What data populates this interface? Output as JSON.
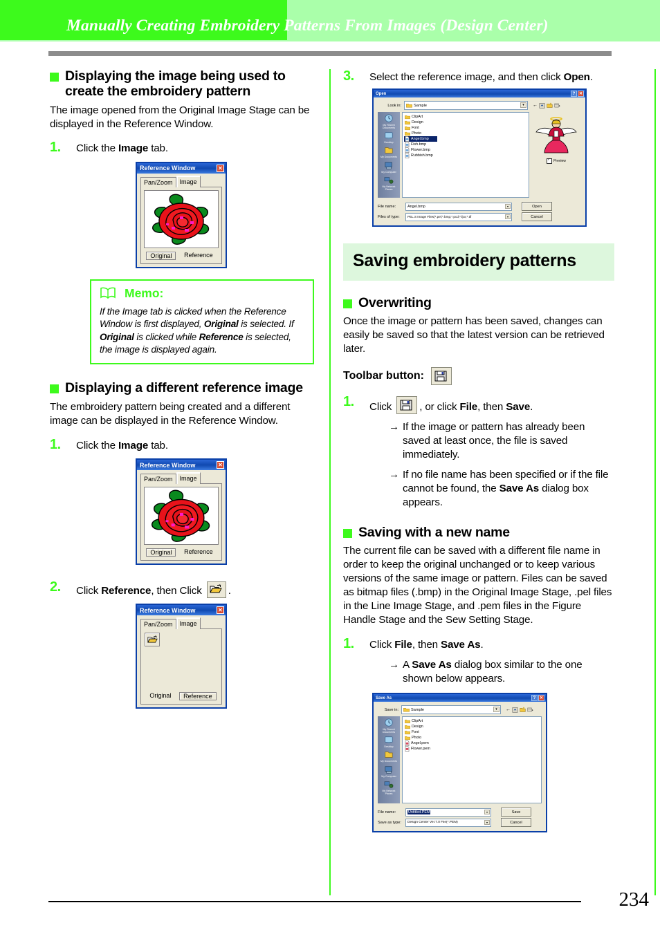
{
  "header": {
    "title": "Manually Creating Embroidery Patterns From Images (Design Center)"
  },
  "left_column": {
    "section1": {
      "heading": "Displaying the image being used to create the embroidery pattern",
      "intro": "The image opened from the Original Image Stage can be displayed in the Reference Window.",
      "step1_num": "1.",
      "step1_text_a": "Click the ",
      "step1_bold": "Image",
      "step1_text_b": " tab."
    },
    "memo": {
      "icon": "book-icon",
      "title": "Memo:",
      "line1_a": "If the Image tab is clicked when the Reference Window is first displayed, ",
      "line1_bold": "Original",
      "line1_b": " is selected. If ",
      "line2_bold": "Original",
      "line2_a": " is clicked while ",
      "line2_bold2": "Reference",
      "line2_b": " is selected, the image is displayed again."
    },
    "section2": {
      "heading": "Displaying a different reference image",
      "intro": "The embroidery pattern being created and a different image can be displayed in the Reference Window.",
      "step1_num": "1.",
      "step1_text_a": "Click the ",
      "step1_bold": "Image",
      "step1_text_b": " tab.",
      "step2_num": "2.",
      "step2_text_a": "Click ",
      "step2_bold": "Reference",
      "step2_text_b": ", then Click ",
      "step2_icon": "open-folder-icon",
      "step2_text_c": "."
    }
  },
  "reference_window": {
    "title": "Reference Window",
    "close_icon": "close-icon",
    "tab_panzoom": "Pan/Zoom",
    "tab_image": "Image",
    "btn_original": "Original",
    "btn_reference": "Reference",
    "image_alt": "rose-image",
    "folder_icon": "open-folder-icon"
  },
  "right_column": {
    "step3": {
      "num": "3.",
      "text_a": "Select the reference image, and then click ",
      "bold": "Open",
      "text_b": "."
    },
    "big_heading": "Saving embroidery patterns",
    "overwriting": {
      "heading": "Overwriting",
      "intro": "Once the image or pattern has been saved, changes can easily be saved so that the latest version can be retrieved later.",
      "toolbar_label": "Toolbar button:",
      "toolbar_icon": "save-floppy-icon",
      "step1_num": "1.",
      "step1_text_a": "Click ",
      "step1_icon": "save-floppy-icon",
      "step1_text_b": ", or click ",
      "step1_bold1": "File",
      "step1_text_c": ", then ",
      "step1_bold2": "Save",
      "step1_text_d": ".",
      "arrow1": "If the image or pattern has already been saved at least once, the file is saved immediately.",
      "arrow2_a": "If no file name has been specified or if the file cannot be found, the ",
      "arrow2_bold": "Save As",
      "arrow2_b": " dialog box appears.",
      "arrow_glyph": "→"
    },
    "newname": {
      "heading": "Saving with a new name",
      "intro": "The current file can be saved with a different file name in order to keep the original unchanged or to keep various versions of the same image or pattern. Files can be saved as bitmap files (.bmp) in the Original Image Stage, .pel files in the Line Image Stage, and .pem files in the Figure Handle Stage and the Sew Setting Stage.",
      "step1_num": "1.",
      "step1_text_a": "Click ",
      "step1_bold1": "File",
      "step1_text_b": ", then ",
      "step1_bold2": "Save As",
      "step1_text_c": ".",
      "arrow1_a": "A ",
      "arrow1_bold": "Save As",
      "arrow1_b": " dialog box similar to the one shown below appears.",
      "arrow_glyph": "→"
    }
  },
  "open_dialog": {
    "title": "Open",
    "help_icon": "help-icon",
    "close_icon": "close-icon",
    "lookin_label": "Look in:",
    "lookin_value": "Sample",
    "places": [
      {
        "label": "My Recent Documents",
        "icon": "recent-documents-icon"
      },
      {
        "label": "Desktop",
        "icon": "desktop-icon"
      },
      {
        "label": "My Documents",
        "icon": "my-documents-icon"
      },
      {
        "label": "My Computer",
        "icon": "my-computer-icon"
      },
      {
        "label": "My Network Places",
        "icon": "network-places-icon"
      }
    ],
    "items": [
      {
        "name": "ClipArt",
        "type": "folder"
      },
      {
        "name": "Design",
        "type": "folder"
      },
      {
        "name": "Font",
        "type": "folder"
      },
      {
        "name": "Photo",
        "type": "folder"
      },
      {
        "name": "Angel.bmp",
        "type": "file",
        "selected": true
      },
      {
        "name": "Fish.bmp",
        "type": "file"
      },
      {
        "name": "Flower.bmp",
        "type": "file"
      },
      {
        "name": "Rubbish.bmp",
        "type": "file"
      }
    ],
    "preview_label": "Preview",
    "preview_image": "angel-image",
    "filename_label": "File name:",
    "filename_value": "Angel.bmp",
    "filetype_label": "Files of type:",
    "filetype_value": "PEL.S Image Files(*.pel;*.bmp;*.pcd;*.fpx;*.tif",
    "btn_open": "Open",
    "btn_cancel": "Cancel"
  },
  "saveas_dialog": {
    "title": "Save As",
    "help_icon": "help-icon",
    "close_icon": "close-icon",
    "savein_label": "Save in:",
    "savein_value": "Sample",
    "places": [
      {
        "label": "My Recent Documents",
        "icon": "recent-documents-icon"
      },
      {
        "label": "Desktop",
        "icon": "desktop-icon"
      },
      {
        "label": "My Documents",
        "icon": "my-documents-icon"
      },
      {
        "label": "My Computer",
        "icon": "my-computer-icon"
      },
      {
        "label": "My Network Places",
        "icon": "network-places-icon"
      }
    ],
    "items": [
      {
        "name": "ClipArt",
        "type": "folder"
      },
      {
        "name": "Design",
        "type": "folder"
      },
      {
        "name": "Font",
        "type": "folder"
      },
      {
        "name": "Photo",
        "type": "folder"
      },
      {
        "name": "Angel.pem",
        "type": "file"
      },
      {
        "name": "Flower.pem",
        "type": "file"
      }
    ],
    "filename_label": "File name:",
    "filename_value": "Untitled.PEM",
    "filetype_label": "Save as type:",
    "filetype_value": "Design Center Ver.7.0 File(*.PEM)",
    "btn_save": "Save",
    "btn_cancel": "Cancel"
  },
  "footer": {
    "page_number": "234"
  },
  "colors": {
    "accent_green": "#3dfa1c",
    "header_light_green": "#aaffaa",
    "section_bg_green": "#ddf7dd",
    "title_blue": "#1049b0"
  }
}
